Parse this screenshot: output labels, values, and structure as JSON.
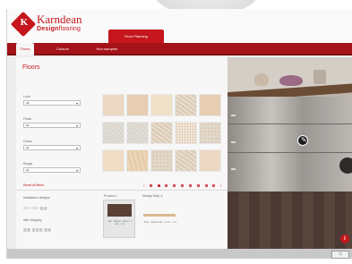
{
  "brand": {
    "name": "Karndean",
    "sub_bold": "Design",
    "sub_rest": "flooring",
    "accent_color": "#c4161c"
  },
  "top_tab": {
    "label": "Floor Planning"
  },
  "nav": {
    "tabs": [
      {
        "label": "Floors",
        "active": true
      },
      {
        "label": "Colours",
        "active": false
      },
      {
        "label": "Your samples",
        "active": false
      }
    ]
  },
  "panel": {
    "title": "Floors",
    "filters": [
      {
        "label": "Look",
        "value": "All"
      },
      {
        "label": "Finish",
        "value": "All"
      },
      {
        "label": "Colour",
        "value": "All"
      },
      {
        "label": "Range",
        "value": "All"
      }
    ],
    "reset_label": "Reset all filters"
  },
  "swatches": [
    "plain1",
    "plain2",
    "cream",
    "stone",
    "plain2",
    "marble",
    "marble",
    "stone",
    "dots",
    "speck",
    "peach",
    "sand",
    "speck",
    "stone",
    "plain1"
  ],
  "pager": {
    "prev_icon": "‹",
    "next_icon": "›",
    "pages": 9,
    "current": 1
  },
  "lower": {
    "installation_label": "Installation designs",
    "installation_scribble": "≡≡≡ ≡≡≡ ▥▥",
    "with_stripping_label": "with stripping",
    "stripping_scribble": "▥▥ ▥▥▥ ▥▥",
    "product_label": "Product 1",
    "product_text": "Van · Walnut · Wood · 1 Jan · 1 m²",
    "design_strip_label": "Design Strip  ✕",
    "design_strip_text": "Strip · Natural Oak · 5 mm · 1 m²"
  },
  "scene": {
    "badge_icon": "✎",
    "info_icon": "i"
  },
  "footer": {
    "button_icon": "⌂"
  }
}
